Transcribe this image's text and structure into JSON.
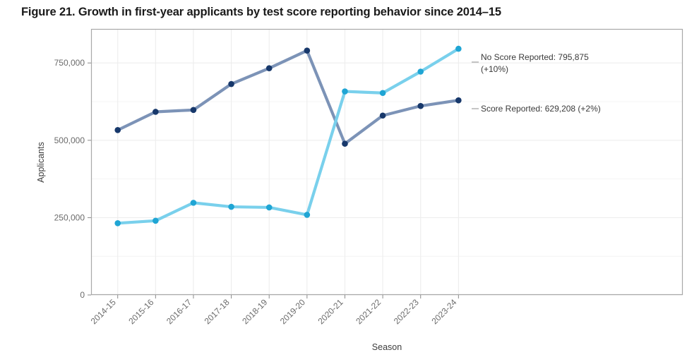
{
  "figure": {
    "title": "Figure 21. Growth in first-year applicants by test score reporting behavior since 2014–15"
  },
  "annotations": {
    "no_score_line1": "No Score Reported: 795,875",
    "no_score_line2": "(+10%)",
    "score_line1": "Score Reported: 629,208 (+2%)"
  },
  "axis": {
    "x_title": "Season",
    "y_title": "Applicants"
  },
  "colors": {
    "no_score_line": "#79D0EC",
    "no_score_point": "#1FA5D4",
    "score_line": "#7C93B7",
    "score_point": "#17386B",
    "grid": "#EDEDED",
    "axis_frame": "#A8A8A8",
    "tick_text": "#6B6B6B"
  },
  "chart_data": {
    "type": "line",
    "title": "Figure 21. Growth in first-year applicants by test score reporting behavior since 2014–15",
    "xlabel": "Season",
    "ylabel": "Applicants",
    "categories": [
      "2014-15",
      "2015-16",
      "2016-17",
      "2017-18",
      "2018-19",
      "2019-20",
      "2020-21",
      "2021-22",
      "2022-23",
      "2023-24"
    ],
    "yticks": [
      0,
      250000,
      500000,
      750000
    ],
    "ytick_labels": [
      "0",
      "250,000",
      "500,000",
      "750,000"
    ],
    "ylim": [
      0,
      860000
    ],
    "grid": true,
    "legend": "annotations-at-line-end",
    "series": [
      {
        "name": "Score Reported",
        "color": "#17386B",
        "line_color": "#7C93B7",
        "values": [
          533000,
          592000,
          598000,
          682000,
          733000,
          790000,
          489000,
          580000,
          611000,
          629208
        ],
        "end_label": "Score Reported: 629,208 (+2%)"
      },
      {
        "name": "No Score Reported",
        "color": "#1FA5D4",
        "line_color": "#79D0EC",
        "values": [
          232000,
          240000,
          298000,
          285000,
          283000,
          259000,
          658000,
          653000,
          722000,
          795875
        ],
        "end_label": "No Score Reported: 795,875 (+10%)"
      }
    ]
  }
}
